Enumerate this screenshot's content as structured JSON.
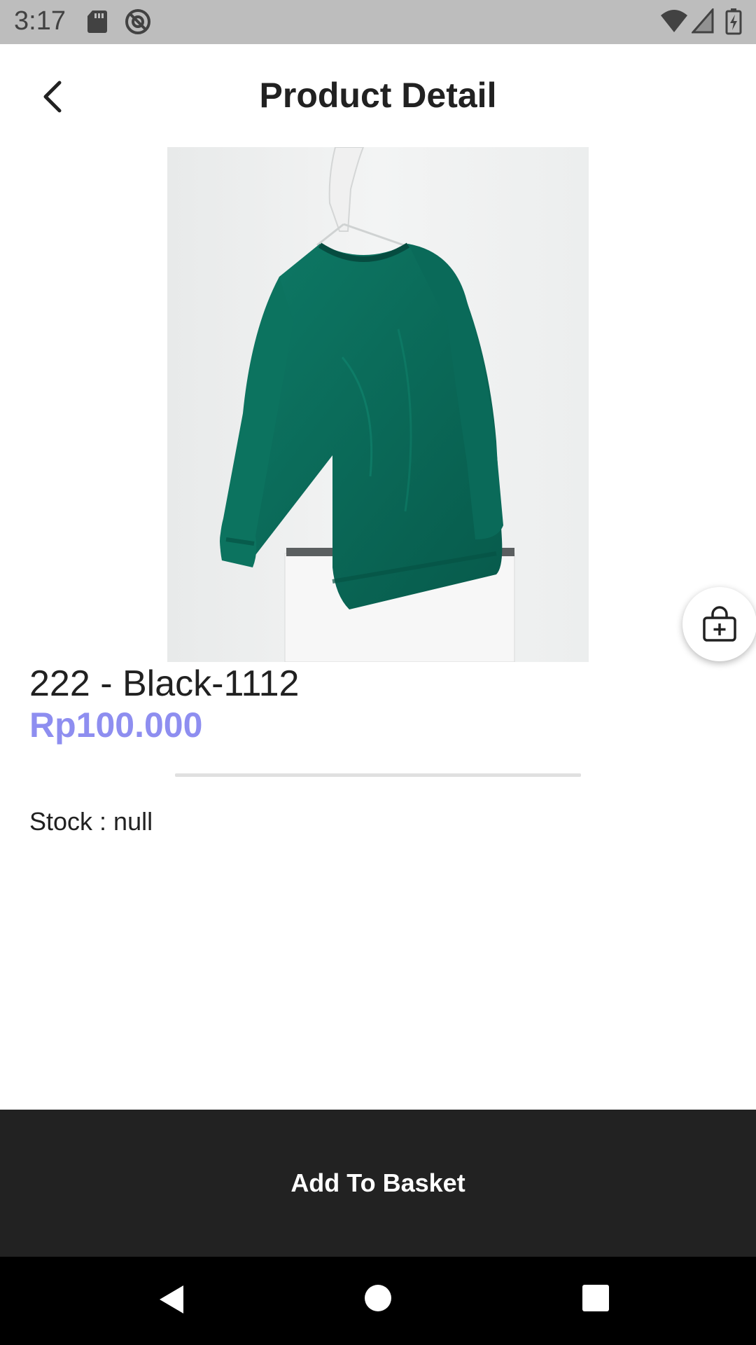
{
  "status_bar": {
    "time": "3:17",
    "icons": [
      "sd-card-icon",
      "do-not-disturb-icon",
      "wifi-icon",
      "signal-icon",
      "battery-charging-icon"
    ]
  },
  "app_bar": {
    "title": "Product Detail",
    "back_icon": "chevron-left-icon"
  },
  "product": {
    "image_description_icon": "product-photo",
    "name": "222 - Black-1112",
    "price": "Rp100.000",
    "stock": "Stock : null"
  },
  "fab": {
    "icon": "basket-add-icon"
  },
  "actions": {
    "add_to_basket": "Add To Basket"
  },
  "nav_bar": {
    "icons": [
      "nav-back-icon",
      "nav-home-icon",
      "nav-recents-icon"
    ]
  },
  "colors": {
    "status_bar": "#bdbdbd",
    "price": "#8e8ef0",
    "button_bg": "#222222",
    "nav_bar": "#000000",
    "sweater": "#0b6b5a"
  }
}
